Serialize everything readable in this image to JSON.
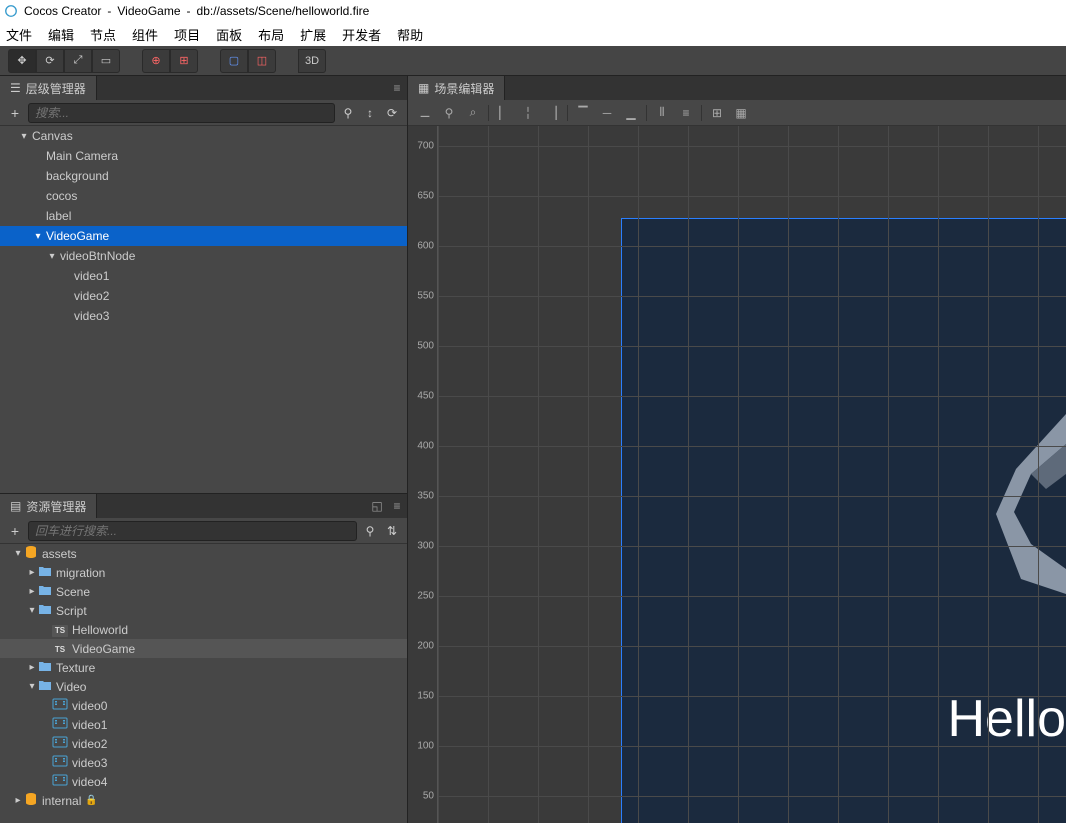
{
  "titlebar": {
    "app": "Cocos Creator",
    "project": "VideoGame",
    "path": "db://assets/Scene/helloworld.fire"
  },
  "menu": [
    "文件",
    "编辑",
    "节点",
    "组件",
    "项目",
    "面板",
    "布局",
    "扩展",
    "开发者",
    "帮助"
  ],
  "toolbar": {
    "mode3d": "3D"
  },
  "panels": {
    "hierarchy": {
      "title": "层级管理器",
      "search_placeholder": "搜索..."
    },
    "assets": {
      "title": "资源管理器",
      "search_placeholder": "回车进行搜索..."
    },
    "scene": {
      "title": "场景编辑器"
    }
  },
  "hierarchy": [
    {
      "label": "Canvas",
      "depth": 0,
      "arrow": "down",
      "selected": false
    },
    {
      "label": "Main Camera",
      "depth": 1,
      "arrow": "",
      "selected": false
    },
    {
      "label": "background",
      "depth": 1,
      "arrow": "",
      "selected": false
    },
    {
      "label": "cocos",
      "depth": 1,
      "arrow": "",
      "selected": false
    },
    {
      "label": "label",
      "depth": 1,
      "arrow": "",
      "selected": false
    },
    {
      "label": "VideoGame",
      "depth": 1,
      "arrow": "down",
      "selected": true
    },
    {
      "label": "videoBtnNode",
      "depth": 2,
      "arrow": "down",
      "selected": false
    },
    {
      "label": "video1",
      "depth": 3,
      "arrow": "",
      "selected": false
    },
    {
      "label": "video2",
      "depth": 3,
      "arrow": "",
      "selected": false
    },
    {
      "label": "video3",
      "depth": 3,
      "arrow": "",
      "selected": false
    }
  ],
  "assets": [
    {
      "label": "assets",
      "depth": 0,
      "arrow": "down",
      "type": "db",
      "selected": false
    },
    {
      "label": "migration",
      "depth": 1,
      "arrow": "right",
      "type": "folder",
      "selected": false
    },
    {
      "label": "Scene",
      "depth": 1,
      "arrow": "right",
      "type": "folder",
      "selected": false
    },
    {
      "label": "Script",
      "depth": 1,
      "arrow": "down",
      "type": "folder",
      "selected": false
    },
    {
      "label": "Helloworld",
      "depth": 2,
      "arrow": "",
      "type": "ts",
      "selected": false
    },
    {
      "label": "VideoGame",
      "depth": 2,
      "arrow": "",
      "type": "ts",
      "selected": true
    },
    {
      "label": "Texture",
      "depth": 1,
      "arrow": "right",
      "type": "folder",
      "selected": false
    },
    {
      "label": "Video",
      "depth": 1,
      "arrow": "down",
      "type": "folder",
      "selected": false
    },
    {
      "label": "video0",
      "depth": 2,
      "arrow": "",
      "type": "video",
      "selected": false
    },
    {
      "label": "video1",
      "depth": 2,
      "arrow": "",
      "type": "video",
      "selected": false
    },
    {
      "label": "video2",
      "depth": 2,
      "arrow": "",
      "type": "video",
      "selected": false
    },
    {
      "label": "video3",
      "depth": 2,
      "arrow": "",
      "type": "video",
      "selected": false
    },
    {
      "label": "video4",
      "depth": 2,
      "arrow": "",
      "type": "video",
      "selected": false
    },
    {
      "label": "internal",
      "depth": 0,
      "arrow": "right",
      "type": "db",
      "selected": false,
      "locked": true
    }
  ],
  "ruler": {
    "ticks": [
      700,
      650,
      600,
      550,
      500,
      450,
      400,
      350,
      300,
      250,
      200,
      150,
      100,
      50
    ]
  },
  "scene": {
    "hello": "Hello"
  }
}
